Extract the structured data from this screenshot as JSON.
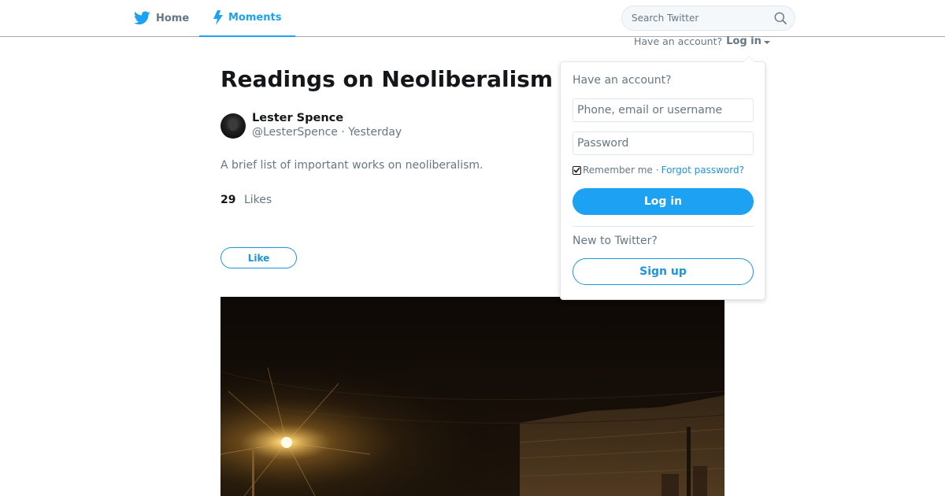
{
  "nav": {
    "home_label": "Home",
    "home_icon": "twitter-bird-icon",
    "moments_label": "Moments",
    "moments_icon": "lightning-bolt-icon",
    "search_placeholder": "Search Twitter"
  },
  "account_bar": {
    "prompt": "Have an account?",
    "login_label": "Log in"
  },
  "moment": {
    "title": "Readings on Neoliberalism 1",
    "author_name": "Lester Spence",
    "author_meta": "@LesterSpence · Yesterday",
    "description": "A brief list of important works on neoliberalism.",
    "likes_count": "29",
    "likes_label": "Likes",
    "like_button": "Like"
  },
  "login_dropdown": {
    "heading": "Have an account?",
    "username_placeholder": "Phone, email or username",
    "password_placeholder": "Password",
    "remember_label": "Remember me",
    "separator": "·",
    "forgot_label": "Forgot password?",
    "remember_checked": true,
    "login_button": "Log in",
    "new_prompt": "New to Twitter?",
    "signup_button": "Sign up"
  },
  "colors": {
    "accent": "#1da1f2",
    "link": "#1b95e0",
    "muted_text": "#657786",
    "primary_text": "#14171a"
  }
}
